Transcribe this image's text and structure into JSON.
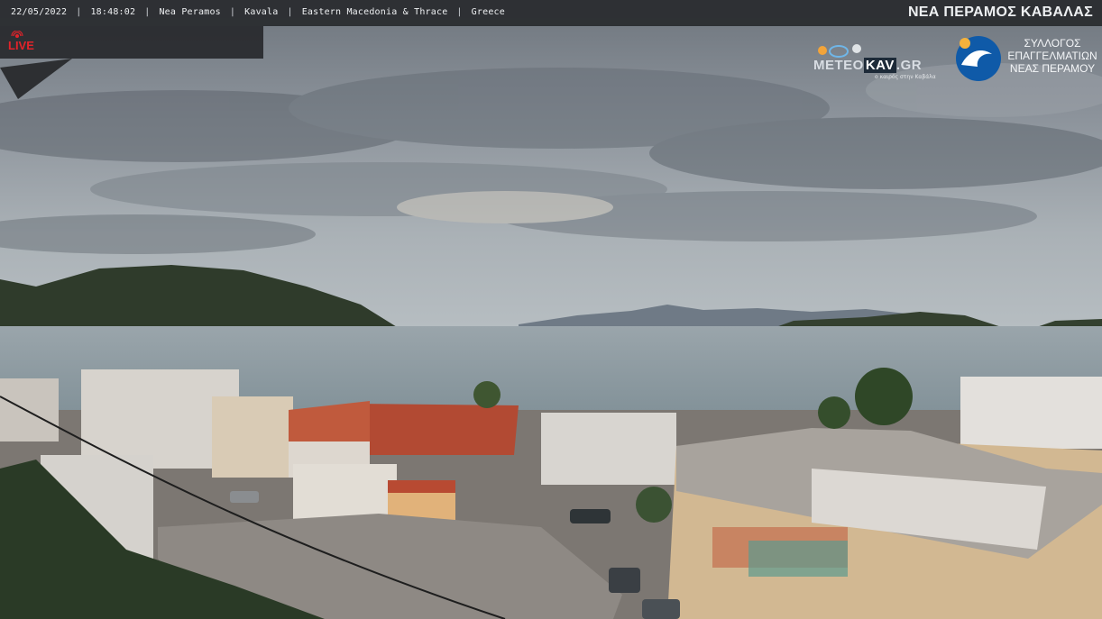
{
  "overlay": {
    "date": "22/05/2022",
    "time": "18:48:02",
    "place": "Nea Peramos",
    "city": "Kavala",
    "region": "Eastern Macedonia & Thrace",
    "country": "Greece",
    "separator": "|",
    "title": "ΝΕΑ ΠΕΡΑΜΟΣ ΚΑΒΑΛΑΣ",
    "live_label": "LIVE"
  },
  "logos": {
    "meteo_prefix": "METEO",
    "meteo_kav": "KAV",
    "meteo_suffix": ".GR",
    "meteo_sub": "ο καιρός στην Καβάλα",
    "association_line1": "ΣΥΛΛΟΓΟΣ",
    "association_line2": "ΕΠΑΓΓΕΛΜΑΤΙΩΝ",
    "association_line3": "ΝΕΑΣ ΠΕΡΑΜΟΥ"
  },
  "scene": {
    "description_icons": [
      "live-broadcast-icon",
      "sun-cloud-icon",
      "wave-icon"
    ],
    "colors": {
      "sky": "#9aa3ab",
      "sea": "#8e9ba2",
      "hill": "#2f3c2c",
      "roof": "#b5482f"
    }
  }
}
